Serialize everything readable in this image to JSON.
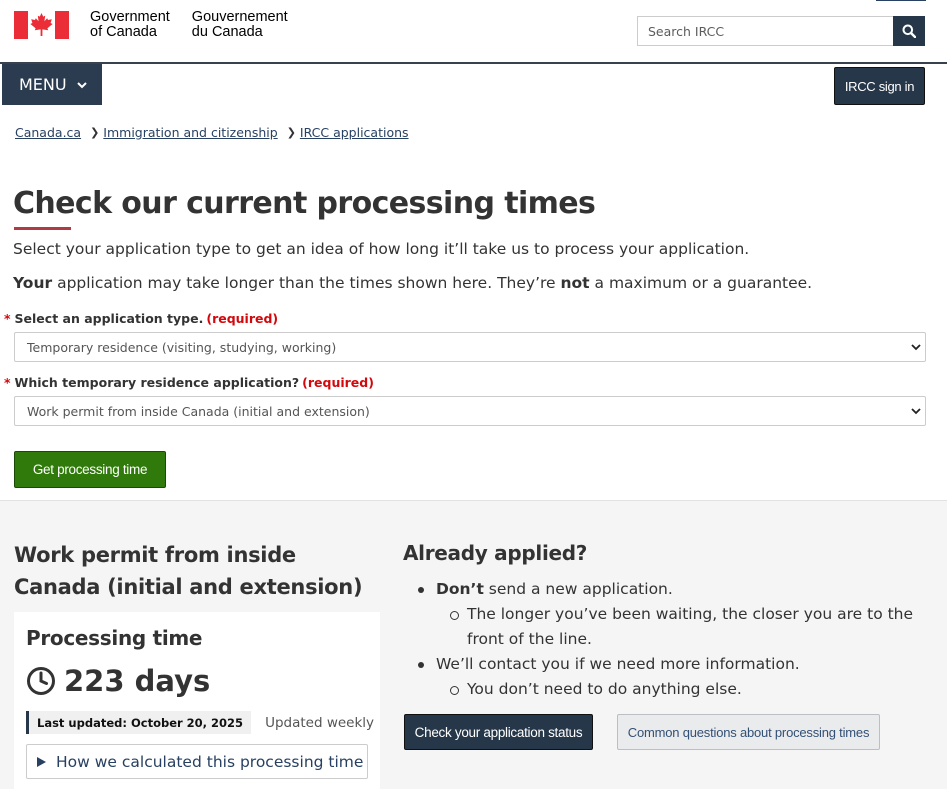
{
  "header": {
    "gov_en_line1": "Government",
    "gov_en_line2": "of Canada",
    "gov_fr_line1": "Gouvernement",
    "gov_fr_line2": "du Canada",
    "search_placeholder": "Search IRCC",
    "menu_label": "MENU",
    "signin_label": "IRCC sign in"
  },
  "breadcrumb": [
    "Canada.ca",
    "Immigration and citizenship",
    "IRCC applications"
  ],
  "main": {
    "title": "Check our current processing times",
    "intro": "Select your application type to get an idea of how long it’ll take us to process your application.",
    "note_bold1": "Your",
    "note_mid": " application may take longer than the times shown here. They’re ",
    "note_bold2": "not",
    "note_end": " a maximum or a guarantee."
  },
  "form": {
    "field1_label": "Select an application type.",
    "field1_value": "Temporary residence (visiting, studying, working)",
    "field2_label": "Which temporary residence application?",
    "field2_value": "Work permit from inside Canada (initial and extension)",
    "required_text": "(required)",
    "submit_label": "Get processing time"
  },
  "results": {
    "title": "Work permit from inside Canada (initial and extension)",
    "card_title": "Processing time",
    "days": "223 days",
    "last_updated": "Last updated: October 20, 2025",
    "frequency": "Updated weekly",
    "how_label": "How we calculated this processing time",
    "applied_title": "Already applied?",
    "item1_bold": "Don’t",
    "item1_rest": " send a new application.",
    "item1_sub": "The longer you’ve been waiting, the closer you are to the front of the line.",
    "item2": "We’ll contact you if we need more information.",
    "item2_sub": "You don’t need to do anything else.",
    "status_button": "Check your application status",
    "faq_button": "Common questions about processing times"
  },
  "colors": {
    "flag_red": "#eb2d37",
    "nav_dark": "#26374a",
    "link": "#284162",
    "required_red": "#d3080c",
    "submit_green": "#2f7a0a",
    "title_rule": "#af3c43"
  }
}
